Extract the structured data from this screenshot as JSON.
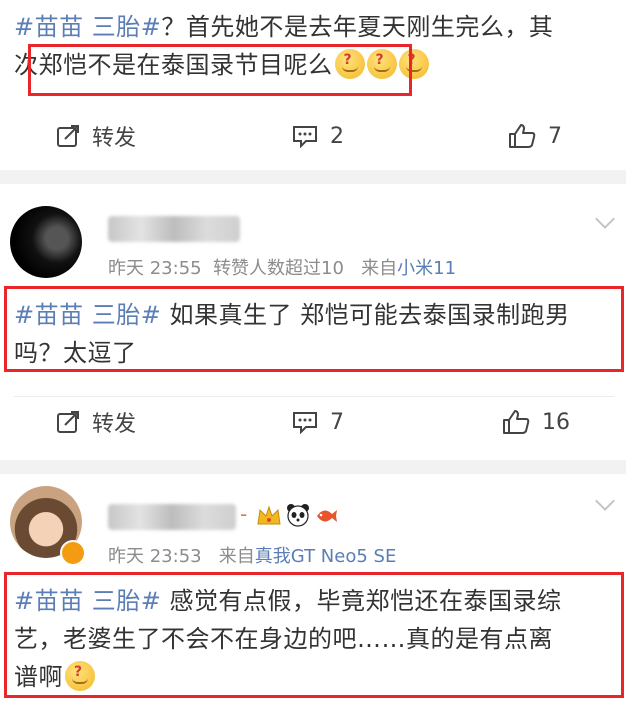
{
  "post1": {
    "line1_topic": "#苗苗 三胎#",
    "line1_rest": "？首先她不是去年夏天刚生完么，其",
    "line2_pre": "次",
    "line2_boxed": "郑恺不是在泰国录节目呢么",
    "actions": {
      "repost": "转发",
      "comments": "2",
      "likes": "7"
    }
  },
  "post2": {
    "time": "昨天 23:55",
    "repost_info": "转赞人数超过10",
    "source_prefix": "来自",
    "source": "小米11",
    "topic": "#苗苗 三胎#",
    "text1": "如果真生了 郑恺可能去泰国录制跑男",
    "text2": "吗？太逗了",
    "actions": {
      "repost": "转发",
      "comments": "7",
      "likes": "16"
    }
  },
  "post3": {
    "name_suffix": "-",
    "time": "昨天 23:53",
    "source_prefix": "来自",
    "source": "真我GT Neo5 SE",
    "topic": "#苗苗 三胎#",
    "text1": "感觉有点假，毕竟郑恺还在泰国录综",
    "text2": "艺，老婆生了不会不在身边的吧……真的是有点离",
    "text3": "谱啊"
  },
  "colors": {
    "topic": "#5b7eb6",
    "highlight_box": "#e8262c",
    "meta": "#8c8c8c",
    "separator": "#f2f2f2"
  }
}
